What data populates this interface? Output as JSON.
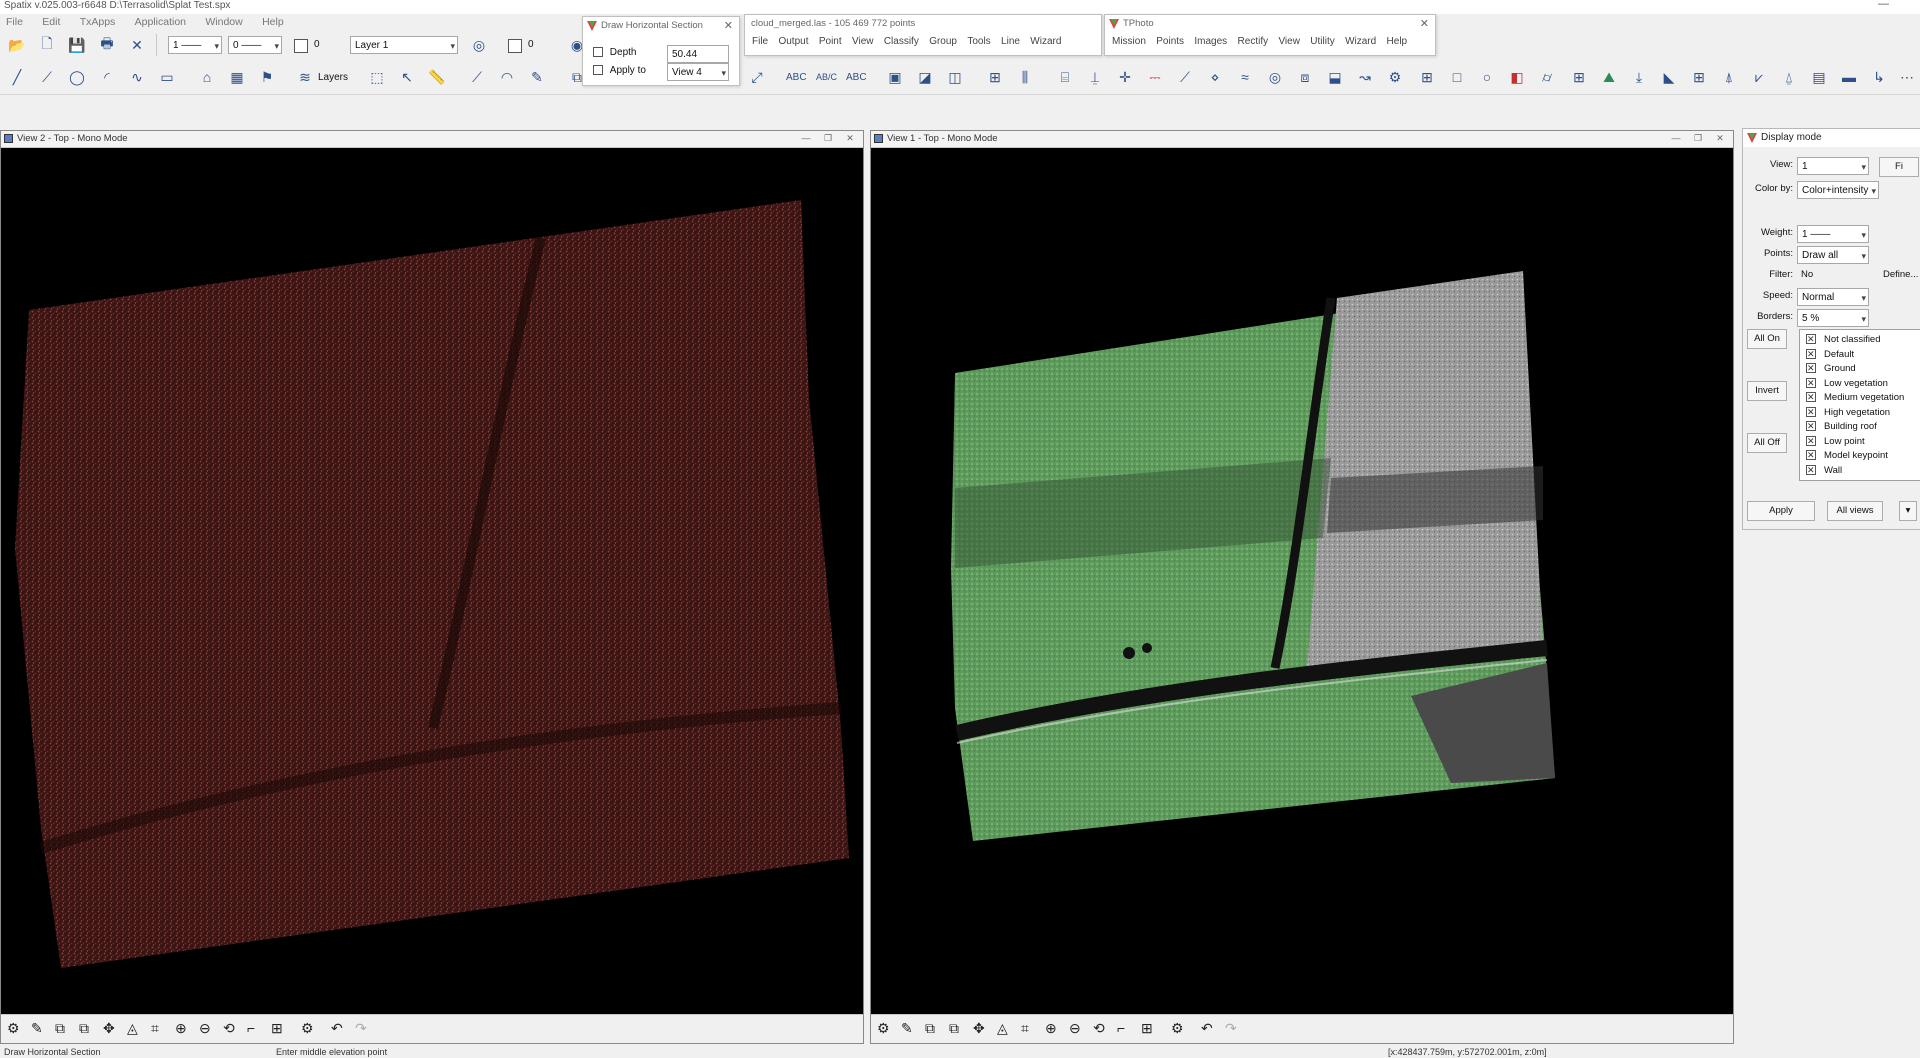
{
  "app": {
    "title": "Spatix v.025.003-r6648  D:\\Terrasolid\\Splat Test.spx",
    "window_controls": [
      "—"
    ]
  },
  "menubar": [
    "File",
    "Edit",
    "TxApps",
    "Application",
    "Window",
    "Help"
  ],
  "toolbar": {
    "line_weight": "1 ——",
    "line_style": "0 ——",
    "color_value": "0",
    "layer": "Layer 1",
    "fill_value": "0",
    "layers_label": "Layers",
    "text_tools": [
      "ABC",
      "AB/C",
      "ABC"
    ]
  },
  "draw_section": {
    "title": "Draw Horizontal Section",
    "depth_label": "Depth",
    "depth_value": "50.44",
    "apply_label": "Apply to",
    "apply_value": "View 4"
  },
  "cloud_window": {
    "title": "cloud_merged.las - 105 469 772 points",
    "menu": [
      "File",
      "Output",
      "Point",
      "View",
      "Classify",
      "Group",
      "Tools",
      "Line",
      "Wizard"
    ]
  },
  "tphoto_window": {
    "title": "TPhoto",
    "menu": [
      "Mission",
      "Points",
      "Images",
      "Rectify",
      "View",
      "Utility",
      "Wizard",
      "Help"
    ]
  },
  "view2": {
    "title": "View 2 - Top - Mono Mode",
    "point_color": "#7a2e2a"
  },
  "view1": {
    "title": "View 1 - Top - Mono Mode"
  },
  "display_mode": {
    "title": "Display mode",
    "view_label": "View:",
    "view_value": "1",
    "colorby_label": "Color by:",
    "colorby_value": "Color+intensity",
    "weight_label": "Weight:",
    "weight_value": "1",
    "points_label": "Points:",
    "points_value": "Draw all",
    "filter_label": "Filter:",
    "filter_value": "No",
    "define_label": "Define...",
    "speed_label": "Speed:",
    "speed_value": "Normal",
    "borders_label": "Borders:",
    "borders_value": "5 %",
    "all_on": "All On",
    "invert": "Invert",
    "all_off": "All Off",
    "classes": [
      "Not classified",
      "Default",
      "Ground",
      "Low vegetation",
      "Medium vegetation",
      "High vegetation",
      "Building roof",
      "Low point",
      "Model keypoint",
      "Wall"
    ],
    "apply": "Apply",
    "all_views": "All views"
  },
  "status": {
    "tool": "Draw Horizontal Section",
    "prompt": "Enter middle elevation point",
    "coords": "[x:428437.759m, y:572702.001m, z:0m]"
  }
}
